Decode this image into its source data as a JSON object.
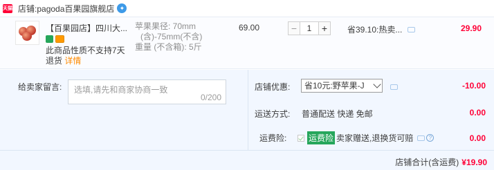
{
  "shop": {
    "badge": "天猫",
    "label": "店铺:",
    "name": "pagoda百果园旗舰店",
    "chat_icon": "chat-icon"
  },
  "item": {
    "image_icon": "apple-thumbnail",
    "title": "【百果园店】四川大...",
    "tags": [
      "tag-green-icon",
      "tag-card-icon"
    ],
    "notice_text": "此商品性质不支持7天退货",
    "notice_link": "详情",
    "spec_line1": "苹果果径: 70mm",
    "spec_line2": "(含)-75mm(不含)",
    "spec_line3": "重量 (不含箱): 5斤",
    "unit_price": "69.00",
    "quantity": "1",
    "qty_minus": "−",
    "qty_plus": "+",
    "discount_text": "省39.10:热卖...",
    "subtotal": "29.90"
  },
  "message": {
    "label": "给卖家留言:",
    "placeholder": "选填,请先和商家协商一致",
    "counter": "0/200"
  },
  "coupon": {
    "label": "店铺优惠:",
    "selected": "省10元:野苹果-J",
    "amount": "-10.00"
  },
  "shipping": {
    "label": "运送方式:",
    "text": "普通配送 快递 免邮",
    "amount": "0.00"
  },
  "insurance": {
    "label": "运费险:",
    "tag": "运费险",
    "text": "卖家赠送,退换货可赔",
    "amount": "0.00"
  },
  "total": {
    "label": "店铺合计(含运费)",
    "amount": "¥19.90"
  },
  "colors": {
    "accent_red": "#ff0036",
    "link_orange": "#ff8a00",
    "panel_bg": "#f2f7ff",
    "insurance_green": "#26a65b"
  }
}
